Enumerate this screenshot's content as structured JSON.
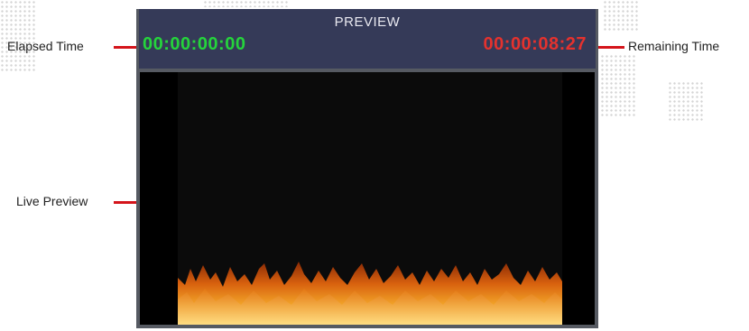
{
  "preview": {
    "title": "PREVIEW",
    "elapsed_time": "00:00:00:00",
    "remaining_time": "00:00:08:27"
  },
  "callouts": {
    "elapsed": "Elapsed Time",
    "remaining": "Remaining Time",
    "live_preview": "Live Preview"
  },
  "colors": {
    "elapsed": "#25d43c",
    "remaining": "#e4322e",
    "header_bg": "#353a58",
    "callout_line": "#d4141b"
  }
}
